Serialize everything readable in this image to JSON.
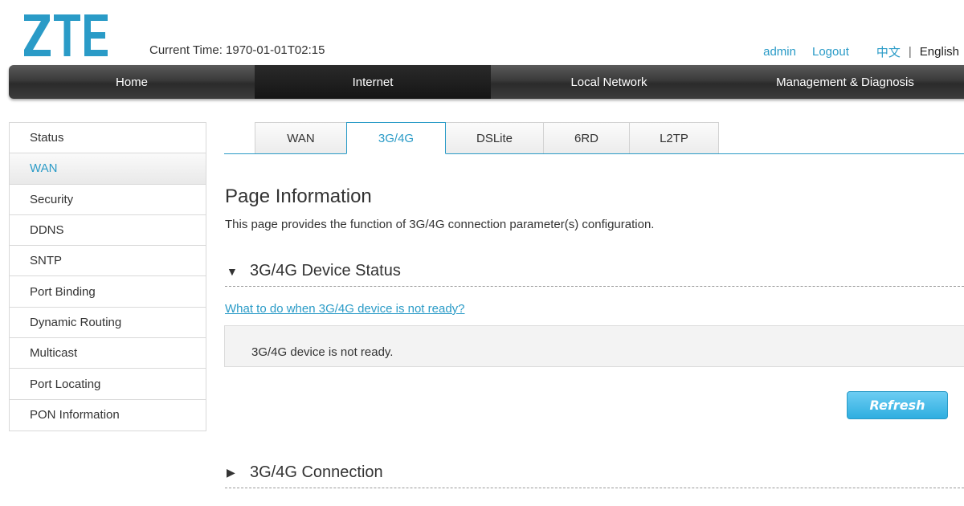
{
  "header": {
    "brand": "ZTE",
    "current_time_label": "Current Time: 1970-01-01T02:15",
    "user": "admin",
    "logout": "Logout",
    "lang_cn": "中文",
    "lang_sep": "|",
    "lang_en": "English"
  },
  "nav": {
    "items": [
      {
        "label": "Home"
      },
      {
        "label": "Internet"
      },
      {
        "label": "Local Network"
      },
      {
        "label": "Management & Diagnosis"
      }
    ],
    "active": "Internet"
  },
  "sidebar": {
    "items": [
      {
        "label": "Status"
      },
      {
        "label": "WAN"
      },
      {
        "label": "Security"
      },
      {
        "label": "DDNS"
      },
      {
        "label": "SNTP"
      },
      {
        "label": "Port Binding"
      },
      {
        "label": "Dynamic Routing"
      },
      {
        "label": "Multicast"
      },
      {
        "label": "Port Locating"
      },
      {
        "label": "PON Information"
      }
    ],
    "active": "WAN"
  },
  "tabs": {
    "items": [
      {
        "label": "WAN"
      },
      {
        "label": "3G/4G"
      },
      {
        "label": "DSLite"
      },
      {
        "label": "6RD"
      },
      {
        "label": "L2TP"
      }
    ],
    "active": "3G/4G"
  },
  "main": {
    "title": "Page Information",
    "description": "This page provides the function of 3G/4G connection parameter(s) configuration.",
    "device_status": {
      "title": "3G/4G Device Status",
      "help_link": "What to do when 3G/4G device is not ready?",
      "status_text": "3G/4G device is not ready.",
      "refresh_label": "Refresh"
    },
    "connection": {
      "title": "3G/4G Connection"
    }
  },
  "colors": {
    "accent": "#2a9bc7",
    "nav_bg": "#3a3a3a",
    "button": "#2eaee0"
  },
  "icons": {
    "expanded": "triangle-down-icon",
    "collapsed": "triangle-right-icon"
  }
}
